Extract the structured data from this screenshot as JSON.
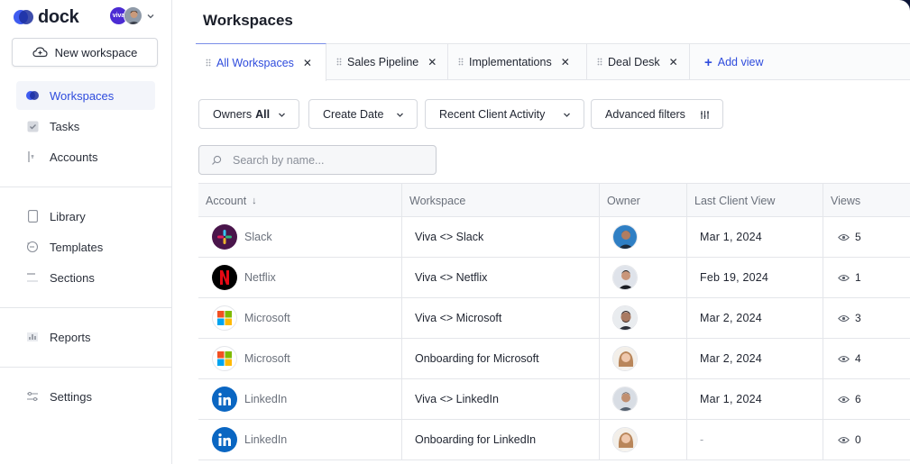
{
  "sidebar": {
    "brand": "dock",
    "account_badge": "viva",
    "new_workspace_label": "New workspace",
    "nav_primary": [
      {
        "label": "Workspaces",
        "icon": "dock-logo-icon",
        "active": true
      },
      {
        "label": "Tasks",
        "icon": "checkbox-icon",
        "active": false
      },
      {
        "label": "Accounts",
        "icon": "accounts-icon",
        "active": false
      }
    ],
    "nav_content": [
      {
        "label": "Library",
        "icon": "document-icon"
      },
      {
        "label": "Templates",
        "icon": "templates-icon"
      },
      {
        "label": "Sections",
        "icon": "sections-icon"
      }
    ],
    "nav_reports": [
      {
        "label": "Reports",
        "icon": "bar-chart-icon"
      }
    ],
    "nav_settings": [
      {
        "label": "Settings",
        "icon": "sliders-icon"
      }
    ]
  },
  "header": {
    "title": "Workspaces"
  },
  "tabs": [
    {
      "label": "All Workspaces",
      "active": true
    },
    {
      "label": "Sales Pipeline",
      "active": false
    },
    {
      "label": "Implementations",
      "active": false
    },
    {
      "label": "Deal Desk",
      "active": false
    }
  ],
  "add_view_label": "Add view",
  "filters": {
    "owners_label": "Owners",
    "owners_value": "All",
    "create_date_label": "Create Date",
    "recent_activity_label": "Recent Client Activity",
    "advanced_label": "Advanced filters"
  },
  "search": {
    "placeholder": "Search by name..."
  },
  "table": {
    "columns": [
      "Account",
      "Workspace",
      "Owner",
      "Last Client View",
      "Views"
    ],
    "sort_indicator": "↓",
    "rows": [
      {
        "account": "Slack",
        "logo": "slack-logo-icon",
        "workspace": "Viva <> Slack",
        "last_view": "Mar 1, 2024",
        "views": "5"
      },
      {
        "account": "Netflix",
        "logo": "netflix-logo-icon",
        "workspace": "Viva <> Netflix",
        "last_view": "Feb 19, 2024",
        "views": "1"
      },
      {
        "account": "Microsoft",
        "logo": "microsoft-logo-icon",
        "workspace": "Viva <> Microsoft",
        "last_view": "Mar 2, 2024",
        "views": "3"
      },
      {
        "account": "Microsoft",
        "logo": "microsoft-logo-icon",
        "workspace": "Onboarding for Microsoft",
        "last_view": "Mar 2, 2024",
        "views": "4"
      },
      {
        "account": "LinkedIn",
        "logo": "linkedin-logo-icon",
        "workspace": "Viva <> LinkedIn",
        "last_view": "Mar 1, 2024",
        "views": "6"
      },
      {
        "account": "LinkedIn",
        "logo": "linkedin-logo-icon",
        "workspace": "Onboarding for LinkedIn",
        "last_view": "-",
        "views": "0"
      }
    ]
  },
  "colors": {
    "accent": "#2f4cdd",
    "frame": "#0b1436",
    "linkedin": "#0a66c2",
    "netflix": "#e50914"
  }
}
